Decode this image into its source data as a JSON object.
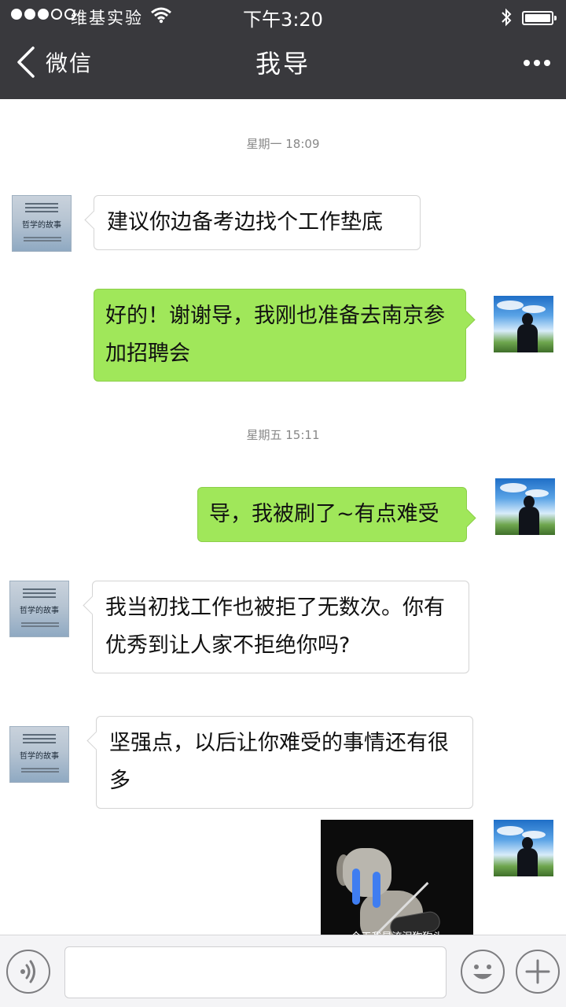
{
  "status_bar": {
    "carrier": "维基实验",
    "time": "下午3:20",
    "signal_icon": "signal-dots-icon",
    "wifi_icon": "wifi-icon",
    "bluetooth_icon": "bluetooth-icon",
    "battery_icon": "battery-icon",
    "battery_level": 1.0
  },
  "nav": {
    "back_label": "微信",
    "title": "我导",
    "back_icon": "chevron-left-icon",
    "more_icon": "more-dots-icon"
  },
  "chat": {
    "timestamps": [
      "星期一 18:09",
      "星期五 15:11"
    ],
    "messages": [
      {
        "from": "advisor",
        "text": "建议你边备考边找个工作垫底"
      },
      {
        "from": "me",
        "text": "好的！谢谢导，我刚也准备去南京参加招聘会"
      },
      {
        "from": "me",
        "text": "导，我被刷了~有点难受"
      },
      {
        "from": "advisor",
        "text": "我当初找工作也被拒了无数次。你有优秀到让人家不拒绝你吗?"
      },
      {
        "from": "advisor",
        "text": "坚强点，以后让你难受的事情还有很多"
      },
      {
        "from": "me",
        "type": "sticker",
        "caption": "今天我是流泪狗狗头"
      }
    ],
    "advisor_avatar": {
      "title": "哲学的故事"
    },
    "colors": {
      "outgoing_bubble": "#a0e75a",
      "incoming_bubble": "#ffffff",
      "nav_bg": "#39393d"
    }
  },
  "input_bar": {
    "voice_icon": "voice-icon",
    "emoji_icon": "emoji-icon",
    "add_icon": "plus-icon"
  }
}
